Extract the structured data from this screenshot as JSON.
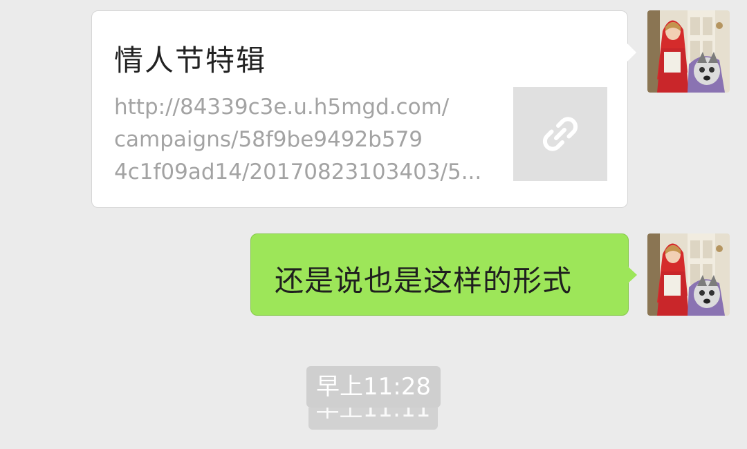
{
  "messages": {
    "link_card": {
      "title": "情人节特辑",
      "url_lines": [
        "http://84339c3e.u.h5mgd.com/",
        "campaigns/58f9be9492b579",
        "4c1f09ad14/20170823103403/5..."
      ],
      "thumbnail_icon": "link-icon"
    },
    "text_message": "还是说也是这样的形式",
    "timestamp": "早上11:28",
    "timestamp_ghost": "早上11:11"
  },
  "colors": {
    "background": "#ebebeb",
    "self_bubble": "#9de659",
    "card_bubble": "#ffffff",
    "timestamp_bg": "#cfcfcf"
  },
  "avatar_icon": "user-avatar-photo"
}
